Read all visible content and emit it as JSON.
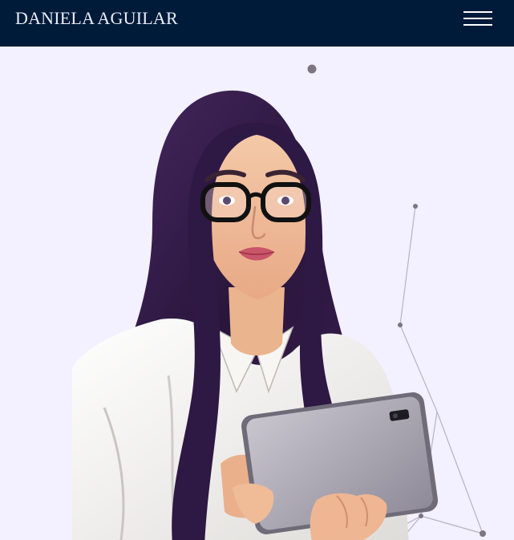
{
  "header": {
    "brand_name": "DANIELA AGUILAR",
    "menu_icon": "hamburger-menu-icon"
  },
  "hero": {
    "illustration": "woman-with-glasses-holding-tablet-illustration",
    "decoration": "network-node-lines"
  },
  "colors": {
    "header_bg": "#001a3a",
    "page_bg": "#f3f0ff",
    "hair": "#3a2150",
    "shirt": "#f2f1ee",
    "tablet": "#a6a3b0",
    "node": "#7a7782"
  }
}
